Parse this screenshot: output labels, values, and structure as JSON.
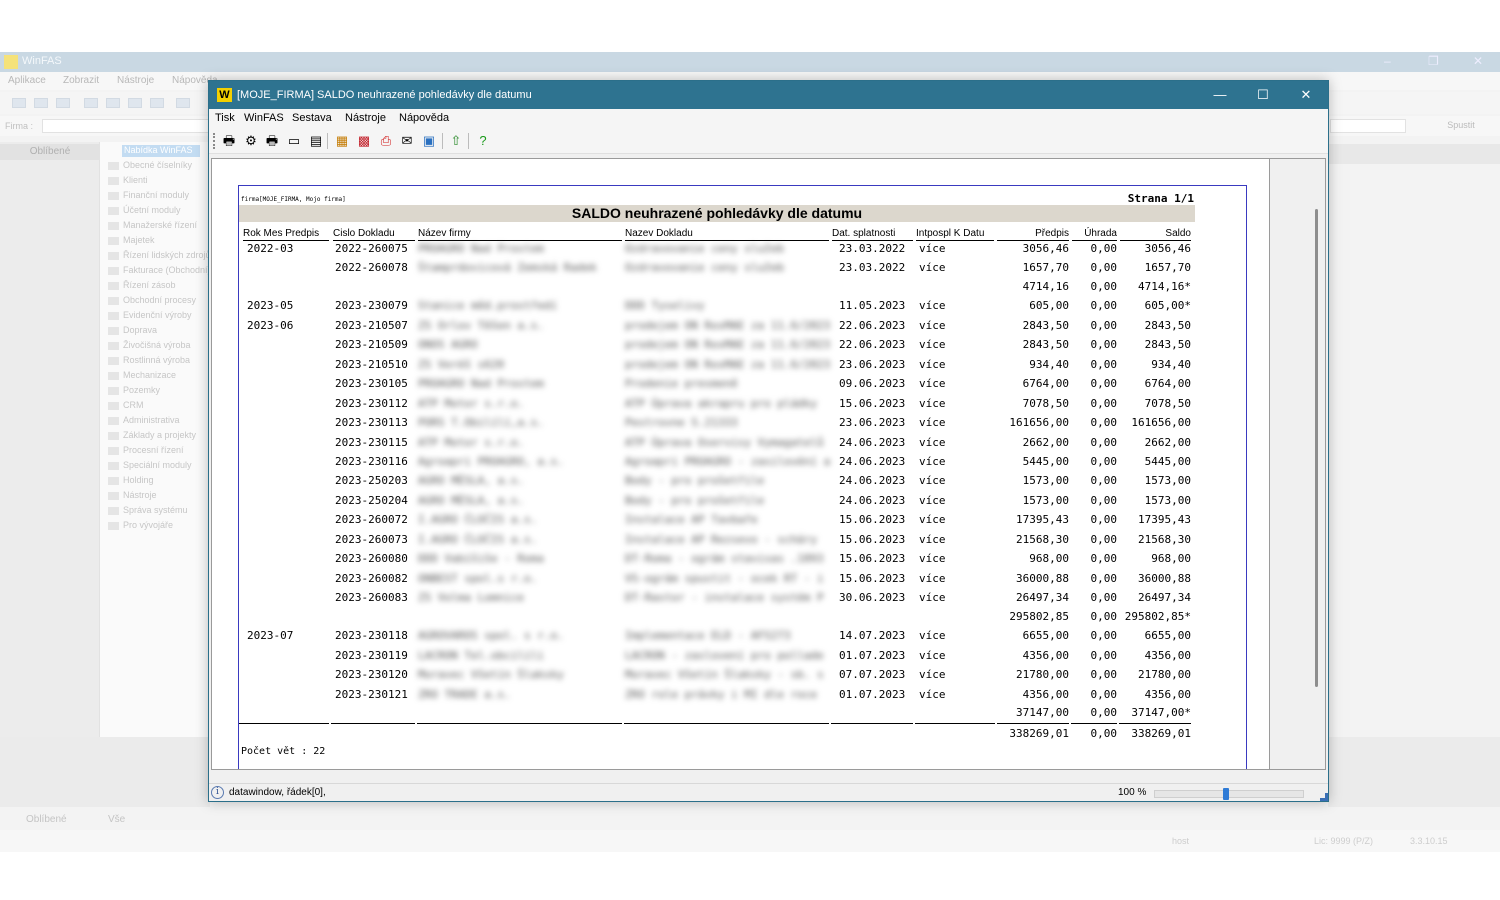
{
  "bg": {
    "app_title": "WinFAS",
    "menu": [
      "Aplikace",
      "Zobrazit",
      "Nástroje",
      "Nápověda"
    ],
    "firma_label": "Firma :",
    "run_button": "Spustit",
    "left_header": "Oblíbené",
    "tree_selected": "Nabídka WinFAS",
    "tree_items": [
      "Obecné číselníky",
      "Klienti",
      "Finanční moduly",
      "Účetní moduly",
      "Manažerské řízení",
      "Majetek",
      "Řízení lidských zdrojů",
      "Fakturace (Obchodní)",
      "Řízení zásob",
      "Obchodní procesy",
      "Evidenční výroby",
      "Doprava",
      "Živočišná výroba",
      "Rostlinná výroba",
      "Mechanizace",
      "Pozemky",
      "CRM",
      "Administrativa",
      "Základy a projekty",
      "Procesní řízení",
      "Speciální moduly",
      "Holding",
      "Nástroje",
      "Správa systému",
      "Pro vývojáře"
    ],
    "tabs": [
      "Oblíbené",
      "Vše"
    ],
    "status_user": "host",
    "status_lic": "Lic: 9999 (P/Z)",
    "status_ver": "3.3.10.15"
  },
  "window": {
    "logo": "W",
    "title": "[MOJE_FIRMA] SALDO neuhrazené pohledávky dle datumu",
    "menu": [
      "Tisk",
      "WinFAS",
      "Sestava",
      "Nástroje",
      "Nápověda"
    ]
  },
  "report": {
    "firma": "firma[MOJE_FIRMA, Mojo firma]",
    "strana": "Strana 1/1",
    "title": "SALDO neuhrazené pohledávky dle datumu",
    "headers": {
      "rok": "Rok Mes Predpis",
      "cislo": "Cislo Dokladu",
      "firma": "Název firmy",
      "doklad": "Nazev Dokladu",
      "splat": "Dat. splatnosti",
      "intpospl": "Intpospl K Datu",
      "predpis": "Předpis",
      "uhrada": "Úhrada",
      "saldo": "Saldo"
    },
    "rows": [
      {
        "rok": "2022-03",
        "cislo": "2022-260075",
        "firma": "PROAGRO Nad Prostem",
        "doklad": "Ozdravovanie ceny služeb",
        "splat": "23.03.2022",
        "int": "více",
        "predpis": "3056,46",
        "uhrada": "0,00",
        "saldo": "3056,46"
      },
      {
        "rok": "",
        "cislo": "2022-260078",
        "firma": "Štamprdovicová Zemská Radek",
        "doklad": "Ozdravovanie ceny služeb",
        "splat": "23.03.2022",
        "int": "více",
        "predpis": "1657,70",
        "uhrada": "0,00",
        "saldo": "1657,70"
      },
      {
        "rok": "",
        "cislo": "",
        "firma": "",
        "doklad": "",
        "splat": "",
        "int": "",
        "predpis": "4714,16",
        "uhrada": "0,00",
        "saldo": "4714,16*"
      },
      {
        "rok": "2023-05",
        "cislo": "2023-230079",
        "firma": "Stanice měd.prostředí",
        "doklad": "DDD Tyselivy",
        "splat": "11.05.2023",
        "int": "více",
        "predpis": "605,00",
        "uhrada": "0,00",
        "saldo": "605,00*"
      },
      {
        "rok": "2023-06",
        "cislo": "2023-210507",
        "firma": "ZS Orlov Těšen a.s.",
        "doklad": "prodejem ON RosMAE za 11.6/2023",
        "splat": "22.06.2023",
        "int": "více",
        "predpis": "2843,50",
        "uhrada": "0,00",
        "saldo": "2843,50"
      },
      {
        "rok": "",
        "cislo": "2023-210509",
        "firma": "ONOS AGRO",
        "doklad": "prodejem ON RosMAE za 11.6/2023",
        "splat": "22.06.2023",
        "int": "více",
        "predpis": "2843,50",
        "uhrada": "0,00",
        "saldo": "2843,50"
      },
      {
        "rok": "",
        "cislo": "2023-210510",
        "firma": "ZS Veréš s620",
        "doklad": "prodejem ON RosMAE za 11.6/2023",
        "splat": "23.06.2023",
        "int": "více",
        "predpis": "934,40",
        "uhrada": "0,00",
        "saldo": "934,40"
      },
      {
        "rok": "",
        "cislo": "2023-230105",
        "firma": "PROAGRO Nad Prostem",
        "doklad": "Prodenie presmeně",
        "splat": "09.06.2023",
        "int": "více",
        "predpis": "6764,00",
        "uhrada": "0,00",
        "saldo": "6764,00"
      },
      {
        "rok": "",
        "cislo": "2023-230112",
        "firma": "ATP Motor s.r.o.",
        "doklad": "ATP Úprava akrapru pro pládky",
        "splat": "15.06.2023",
        "int": "více",
        "predpis": "7078,50",
        "uhrada": "0,00",
        "saldo": "7078,50"
      },
      {
        "rok": "",
        "cislo": "2023-230113",
        "firma": "PORS T.Obilílí,a.s.",
        "doklad": "Pestrovne S.21333",
        "splat": "23.06.2023",
        "int": "více",
        "predpis": "161656,00",
        "uhrada": "0,00",
        "saldo": "161656,00"
      },
      {
        "rok": "",
        "cislo": "2023-230115",
        "firma": "ATP Motor s.r.o.",
        "doklad": "ATP Úprava Oservisy Vymagatelů",
        "splat": "24.06.2023",
        "int": "více",
        "predpis": "2662,00",
        "uhrada": "0,00",
        "saldo": "2662,00"
      },
      {
        "rok": "",
        "cislo": "2023-230116",
        "firma": "Agroapri PROAGRO, a.s.",
        "doklad": "Agroapri PROAGRO - zasilovéní a",
        "splat": "24.06.2023",
        "int": "více",
        "predpis": "5445,00",
        "uhrada": "0,00",
        "saldo": "5445,00"
      },
      {
        "rok": "",
        "cislo": "2023-250203",
        "firma": "AGRO MÉSLA, a.s.",
        "doklad": "Body - pro prošetřile",
        "splat": "24.06.2023",
        "int": "více",
        "predpis": "1573,00",
        "uhrada": "0,00",
        "saldo": "1573,00"
      },
      {
        "rok": "",
        "cislo": "2023-250204",
        "firma": "AGRO MÉSLA, a.s.",
        "doklad": "Body - pro prošetřile",
        "splat": "24.06.2023",
        "int": "více",
        "predpis": "1573,00",
        "uhrada": "0,00",
        "saldo": "1573,00"
      },
      {
        "rok": "",
        "cislo": "2023-260072",
        "firma": "I.AGRO ČLOČIS a.s.",
        "doklad": "Instalace AP Tavbaře",
        "splat": "15.06.2023",
        "int": "více",
        "predpis": "17395,43",
        "uhrada": "0,00",
        "saldo": "17395,43"
      },
      {
        "rok": "",
        "cislo": "2023-260073",
        "firma": "I.AGRO ČLOČIS a.s.",
        "doklad": "Instalace AP Rezsevo - scháry",
        "splat": "15.06.2023",
        "int": "více",
        "predpis": "21568,30",
        "uhrada": "0,00",
        "saldo": "21568,30"
      },
      {
        "rok": "",
        "cislo": "2023-260080",
        "firma": "DDD Vabíšiše - Roma",
        "doklad": "DT-Roma - ográm stavisas .1893",
        "splat": "15.06.2023",
        "int": "více",
        "predpis": "968,00",
        "uhrada": "0,00",
        "saldo": "968,00"
      },
      {
        "rok": "",
        "cislo": "2023-260082",
        "firma": "ONBEST spol.s r.o.",
        "doklad": "VS-ográm spustit - ocek RT - i",
        "splat": "15.06.2023",
        "int": "více",
        "predpis": "36000,88",
        "uhrada": "0,00",
        "saldo": "36000,88"
      },
      {
        "rok": "",
        "cislo": "2023-260083",
        "firma": "ZS Volma Lomnice",
        "doklad": "DT-Rastor - instalace systém P",
        "splat": "30.06.2023",
        "int": "více",
        "predpis": "26497,34",
        "uhrada": "0,00",
        "saldo": "26497,34"
      },
      {
        "rok": "",
        "cislo": "",
        "firma": "",
        "doklad": "",
        "splat": "",
        "int": "",
        "predpis": "295802,85",
        "uhrada": "0,00",
        "saldo": "295802,85*"
      },
      {
        "rok": "2023-07",
        "cislo": "2023-230118",
        "firma": "AGROVAROS spol. s r.o.",
        "doklad": "Implementace ELD - AFS273",
        "splat": "14.07.2023",
        "int": "více",
        "predpis": "6655,00",
        "uhrada": "0,00",
        "saldo": "6655,00"
      },
      {
        "rok": "",
        "cislo": "2023-230119",
        "firma": "LACRON Tel.obcilili",
        "doklad": "LACRON - zaslovení pro pollade",
        "splat": "01.07.2023",
        "int": "více",
        "predpis": "4356,00",
        "uhrada": "0,00",
        "saldo": "4356,00"
      },
      {
        "rok": "",
        "cislo": "2023-230120",
        "firma": "Moravec Všetín Šlaksky",
        "doklad": "Moravec Všetín Šlaksky - sb. s",
        "splat": "07.07.2023",
        "int": "více",
        "predpis": "21780,00",
        "uhrada": "0,00",
        "saldo": "21780,00"
      },
      {
        "rok": "",
        "cislo": "2023-230121",
        "firma": "ZRO TRADE a.s.",
        "doklad": "ZRO role právky i MI dle roce",
        "splat": "01.07.2023",
        "int": "více",
        "predpis": "4356,00",
        "uhrada": "0,00",
        "saldo": "4356,00"
      },
      {
        "rok": "",
        "cislo": "",
        "firma": "",
        "doklad": "",
        "splat": "",
        "int": "",
        "predpis": "37147,00",
        "uhrada": "0,00",
        "saldo": "37147,00*"
      }
    ],
    "total": {
      "predpis": "338269,01",
      "uhrada": "0,00",
      "saldo": "338269,01"
    },
    "pocet": "Počet vět : 22"
  },
  "status": {
    "text": "datawindow, řádek[0],",
    "zoom": "100 %",
    "zoom_fraction": 0.47
  },
  "colors": {
    "title_bar": "#2e7390",
    "report_title_bg": "#dcd7cd",
    "page_border": "#3a3ac0"
  }
}
